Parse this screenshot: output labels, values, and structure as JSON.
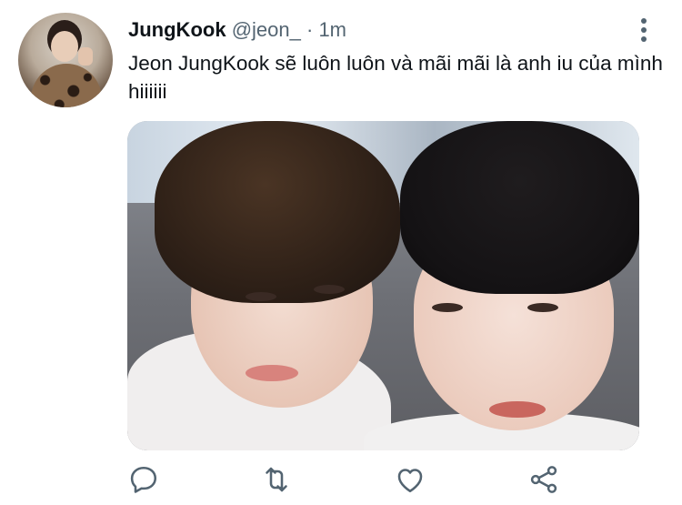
{
  "tweet": {
    "author_name": "JungKook",
    "author_handle": "@jeon_",
    "separator": "·",
    "timestamp": "1m",
    "text": "Jeon JungKook sẽ luôn luôn và mãi mãi là anh iu của mình hiiiiii"
  },
  "actions": {
    "reply": "reply-icon",
    "retweet": "retweet-icon",
    "like": "heart-icon",
    "share": "share-icon"
  },
  "colors": {
    "text_primary": "#0f1419",
    "text_secondary": "#536471",
    "background": "#ffffff"
  }
}
